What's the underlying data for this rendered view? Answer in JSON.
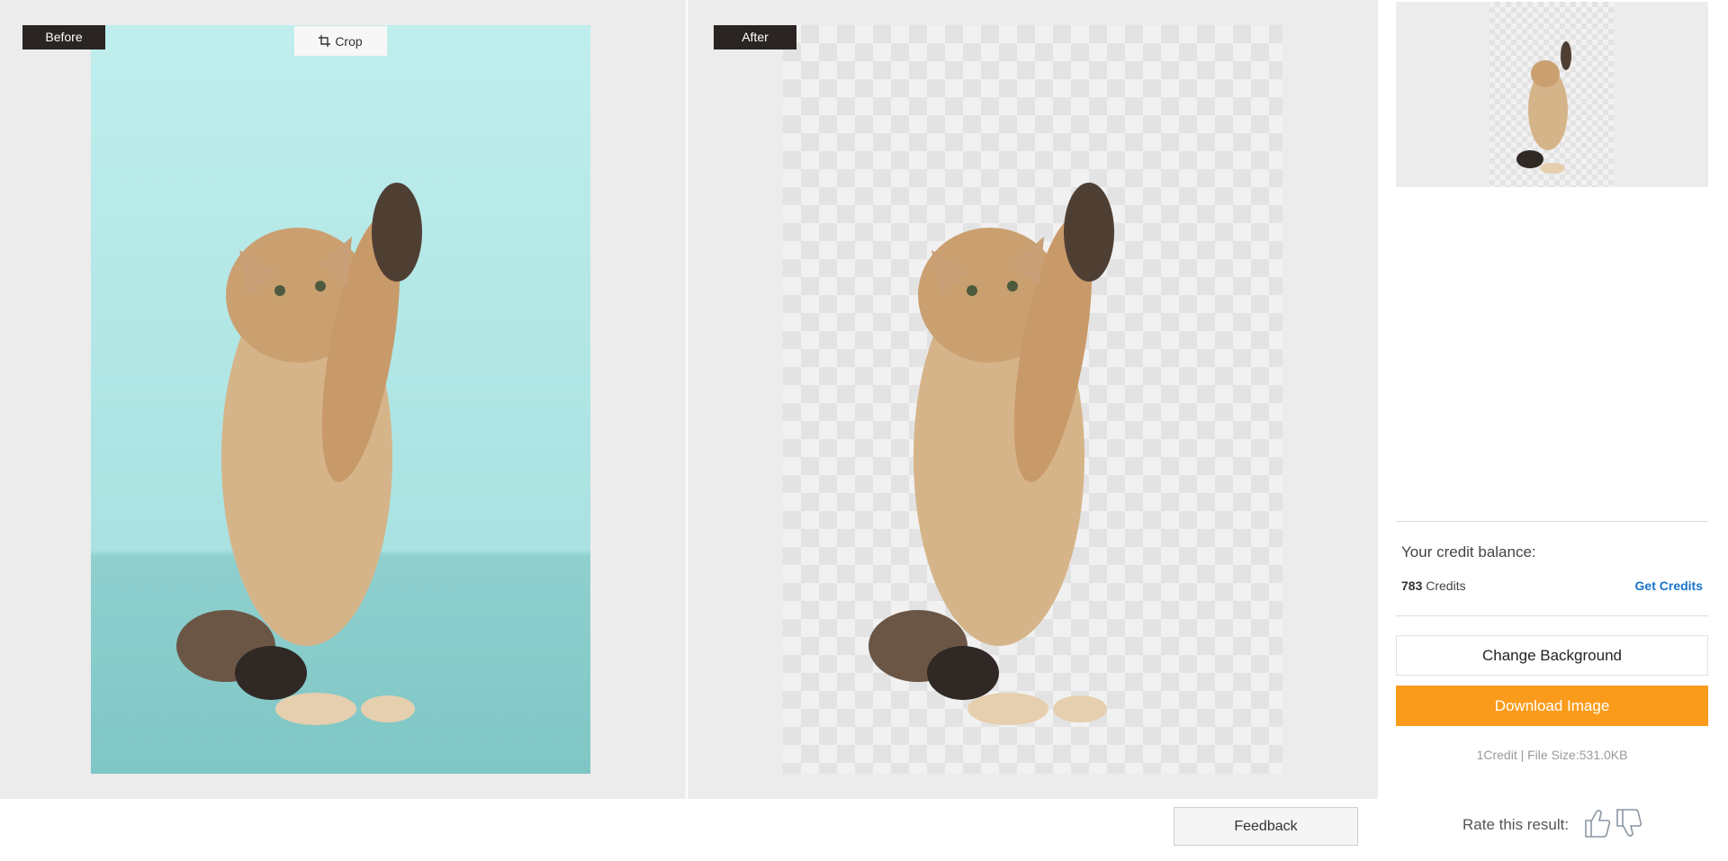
{
  "before_pane": {
    "label": "Before",
    "crop_label": "Crop"
  },
  "after_pane": {
    "label": "After"
  },
  "sidebar": {
    "credit_title": "Your credit balance:",
    "credit_amount": "783",
    "credit_unit": "Credits",
    "get_credits_label": "Get Credits",
    "change_background_label": "Change Background",
    "download_label": "Download Image",
    "file_info": "1Credit | File Size:531.0KB",
    "rate_label": "Rate this result"
  },
  "feedback_label": "Feedback",
  "icons": {
    "crop": "crop-icon",
    "thumbs_up": "thumbs-up-icon",
    "thumbs_down": "thumbs-down-icon"
  },
  "colors": {
    "accent": "#fb9b1b",
    "link": "#1a73c8",
    "tag_bg": "#2a2423",
    "original_background": "#b5e7e6"
  }
}
